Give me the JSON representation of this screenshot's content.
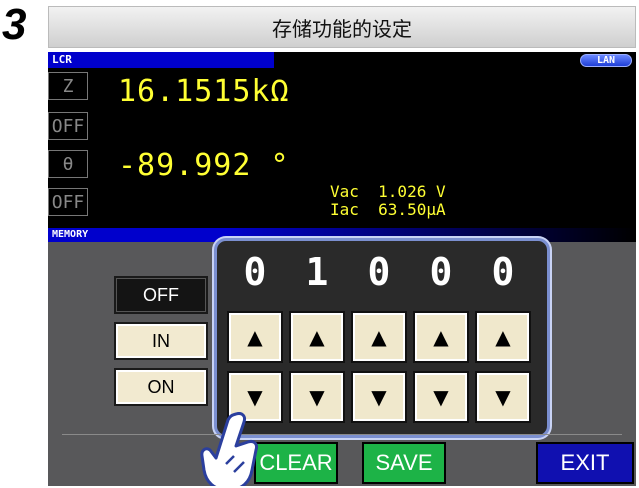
{
  "step_number": "3",
  "title": "存储功能的设定",
  "status_bar": {
    "mode": "LCR",
    "lan": "LAN"
  },
  "measurement": {
    "param1": {
      "label": "Z",
      "toggle": "OFF",
      "value": "16.1515kΩ"
    },
    "param2": {
      "label": "θ",
      "toggle": "OFF",
      "value": "-89.992 °"
    },
    "vac": "Vac  1.026 V",
    "iac": "Iac  63.50μA"
  },
  "memory": {
    "section_label": "MEMORY",
    "modes": [
      "OFF",
      "IN",
      "ON"
    ],
    "selected_mode": "OFF",
    "digits": [
      "0",
      "1",
      "0",
      "0",
      "0"
    ],
    "up_arrow": "▲",
    "down_arrow": "▼"
  },
  "buttons": {
    "clear": "CLEAR",
    "save": "SAVE",
    "exit": "EXIT"
  },
  "colors": {
    "accent_blue": "#0000cc",
    "value_yellow": "#ffff33",
    "green_button": "#1db347",
    "exit_blue": "#1010b0",
    "highlight_border": "#7b8fd0"
  }
}
